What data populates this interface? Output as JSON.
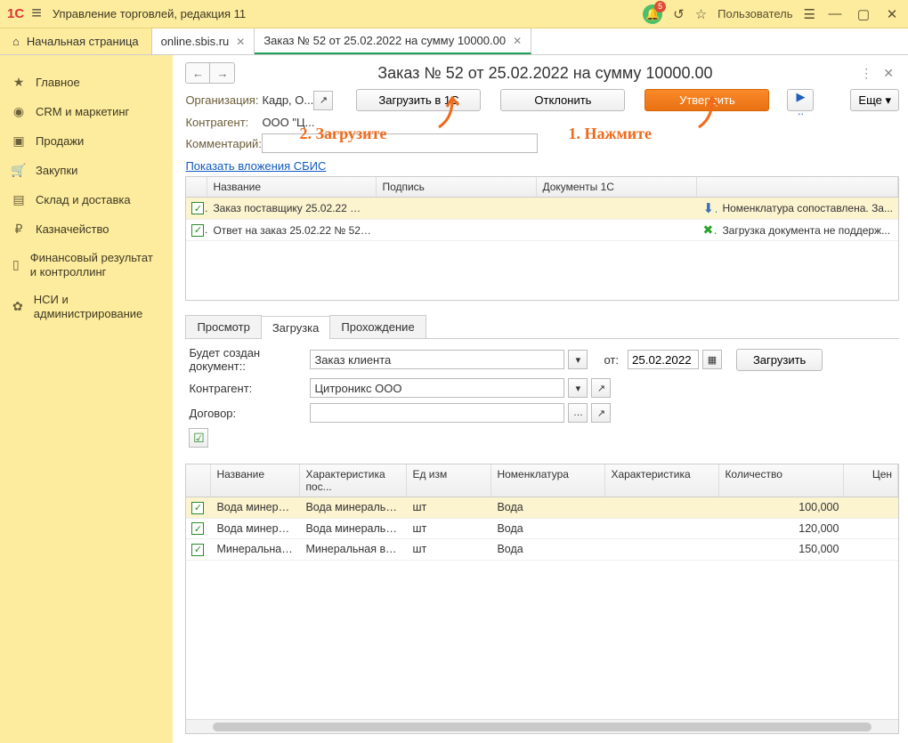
{
  "topbar": {
    "title": "Управление торговлей, редакция 11",
    "badge": "5",
    "user": "Пользователь"
  },
  "tabs": {
    "home": "Начальная страница",
    "t1": "online.sbis.ru",
    "t2": "Заказ № 52 от 25.02.2022 на сумму 10000.00"
  },
  "sidebar": {
    "items": [
      {
        "icon": "★",
        "label": "Главное"
      },
      {
        "icon": "◉",
        "label": "CRM и маркетинг"
      },
      {
        "icon": "▣",
        "label": "Продажи"
      },
      {
        "icon": "🛒",
        "label": "Закупки"
      },
      {
        "icon": "▤",
        "label": "Склад и доставка"
      },
      {
        "icon": "₽",
        "label": "Казначейство"
      },
      {
        "icon": "▯",
        "label": "Финансовый результат и контроллинг"
      },
      {
        "icon": "✿",
        "label": "НСИ и администрирование"
      }
    ]
  },
  "doc": {
    "title": "Заказ № 52 от 25.02.2022 на сумму 10000.00",
    "org_label": "Организация:",
    "org_val": "Кадр, О...",
    "kontr_label": "Контрагент:",
    "kontr_val": "ООО \"Ц...",
    "comment_label": "Комментарий:",
    "btn_load": "Загрузить в 1С",
    "btn_reject": "Отклонить",
    "btn_approve": "Утвердить",
    "btn_more": "Еще",
    "attach_link": "Показать вложения СБИС",
    "ann1": "1. Нажмите",
    "ann2": "2. Загрузите"
  },
  "top_table": {
    "h1": "Название",
    "h2": "Подпись",
    "h3": "Документы 1С",
    "rows": [
      {
        "name": "Заказ поставщику 25.02.22 № 5...",
        "icon": "⬇",
        "status": "Номенклатура сопоставлена. За..."
      },
      {
        "name": "Ответ на заказ 25.02.22 № 52 на...",
        "icon": "✖",
        "status": "Загрузка документа не поддерж..."
      }
    ]
  },
  "inner_tabs": {
    "t1": "Просмотр",
    "t2": "Загрузка",
    "t3": "Прохождение"
  },
  "form": {
    "doc_label": "Будет создан документ::",
    "doc_val": "Заказ клиента",
    "date_lab": "от:",
    "date_val": "25.02.2022",
    "btn_load": "Загрузить",
    "kon_label": "Контрагент:",
    "kon_val": "Цитроникс ООО",
    "dog_label": "Договор:"
  },
  "items_table": {
    "h1": "Название",
    "h2": "Характеристика пос...",
    "h3": "Ед изм",
    "h4": "Номенклатура",
    "h5": "Характеристика",
    "h6": "Количество",
    "h7": "Цен",
    "rows": [
      {
        "name": "Вода минераль...",
        "char": "Вода минеральная ...",
        "unit": "шт",
        "nom": "Вода",
        "qty": "100,000"
      },
      {
        "name": "Вода минераль...",
        "char": "Вода минеральная ...",
        "unit": "шт",
        "nom": "Вода",
        "qty": "120,000"
      },
      {
        "name": "Минеральная в...",
        "char": "Минеральная вода ...",
        "unit": "шт",
        "nom": "Вода",
        "qty": "150,000"
      }
    ]
  }
}
